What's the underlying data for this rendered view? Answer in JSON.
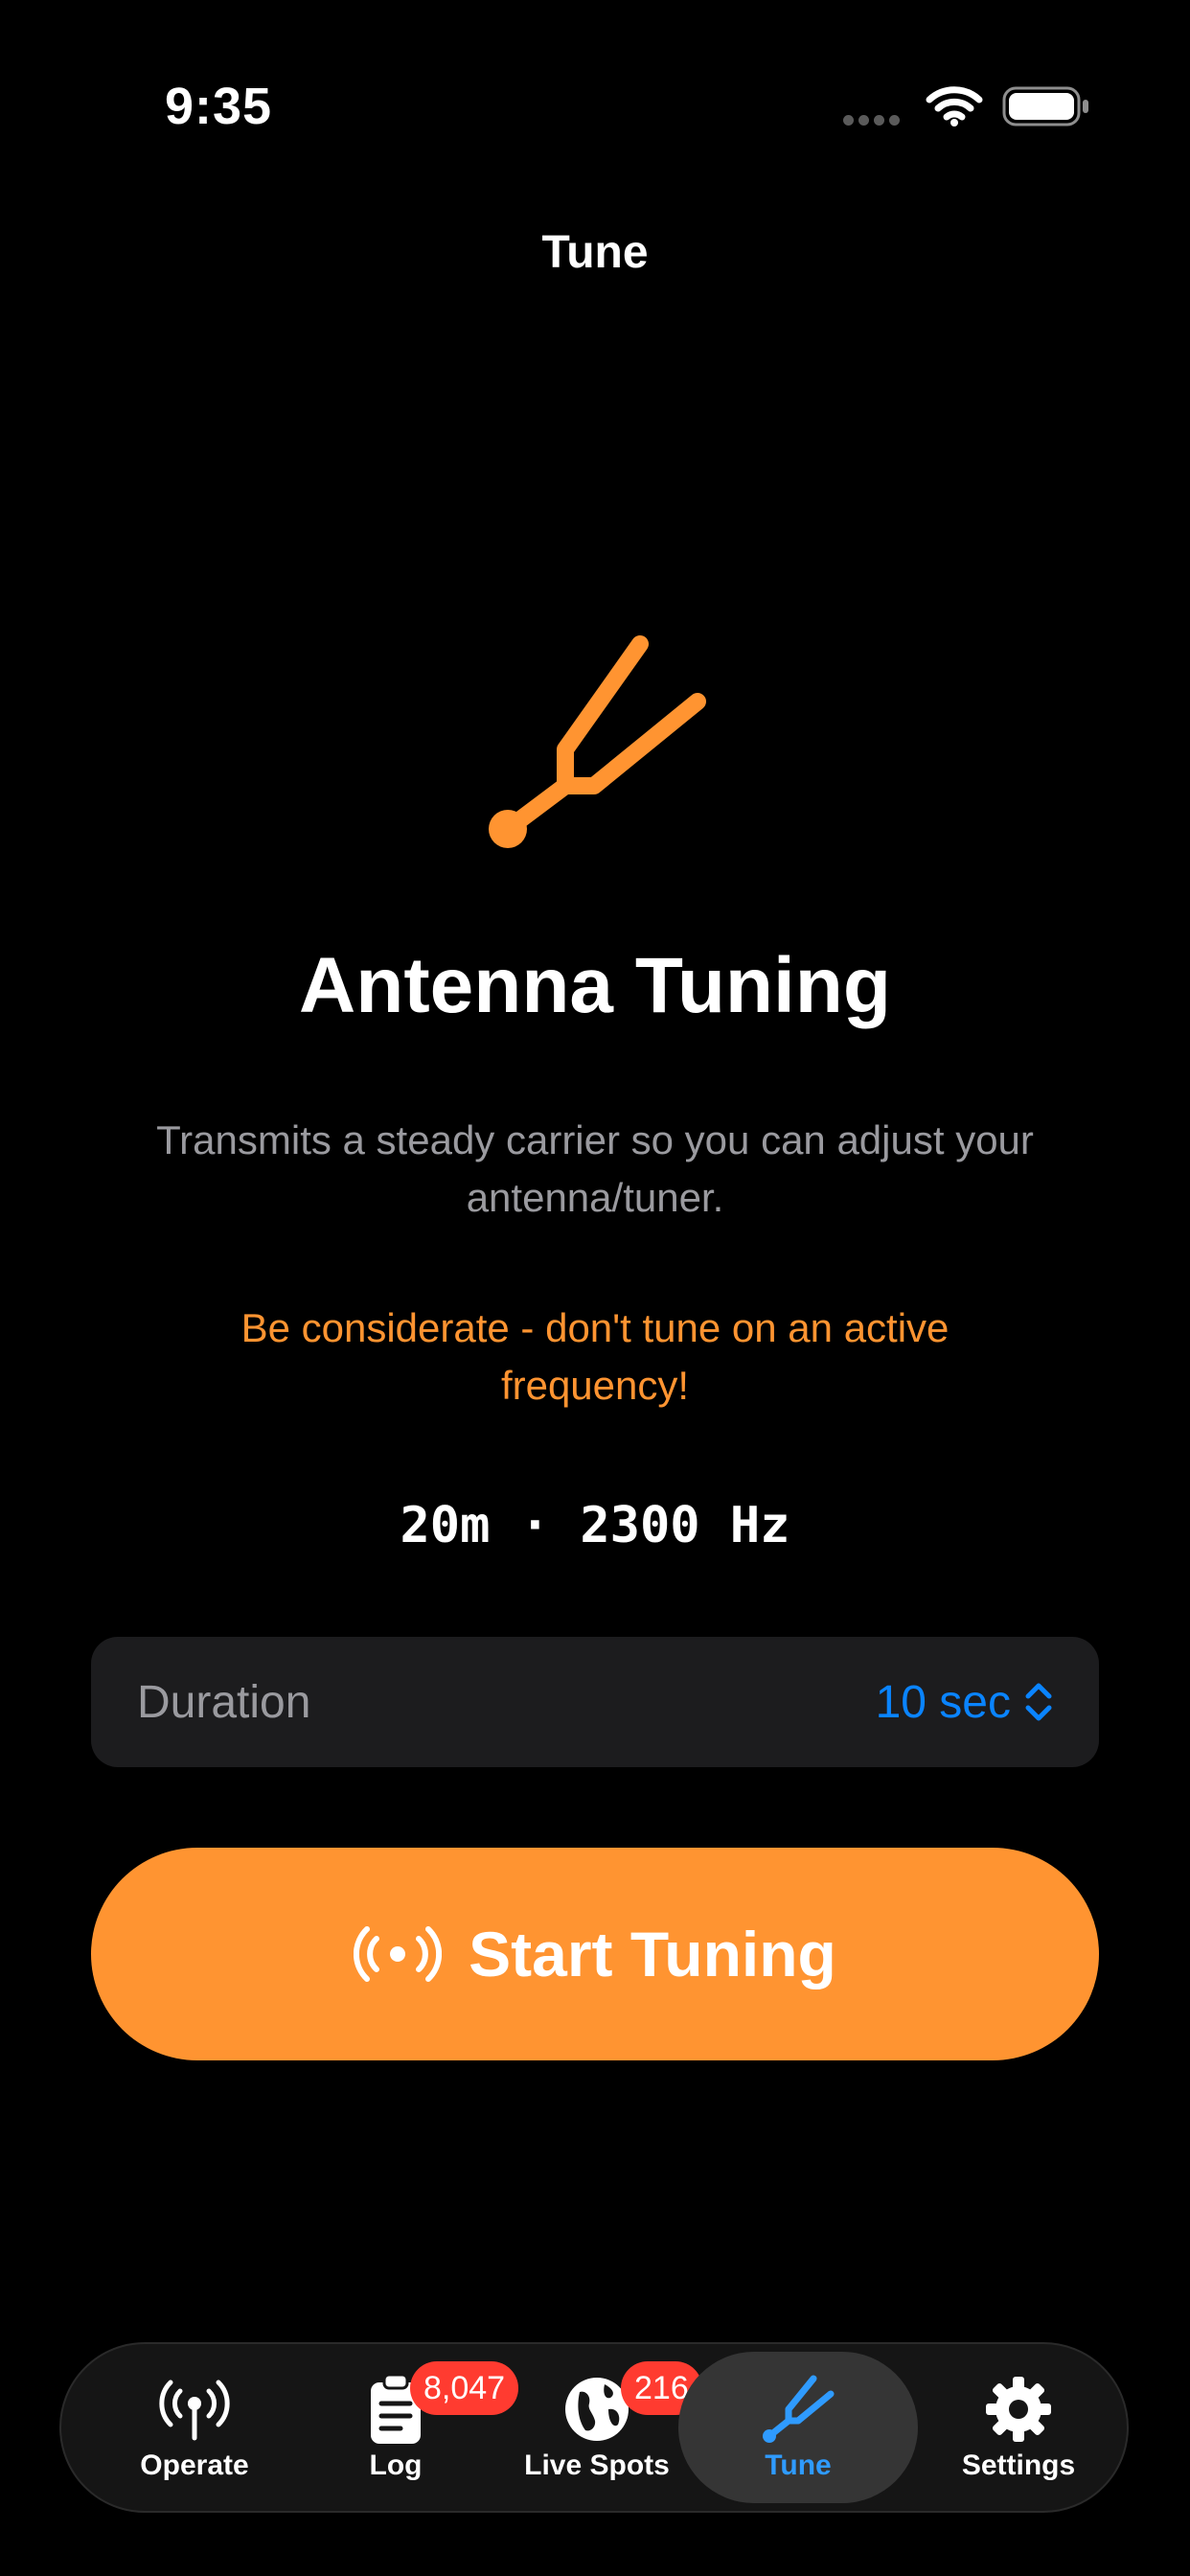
{
  "status_bar": {
    "time": "9:35"
  },
  "nav": {
    "title": "Tune"
  },
  "hero": {
    "icon": "tuning-fork-icon",
    "accent": "#ff9431"
  },
  "main": {
    "title": "Antenna Tuning",
    "description": "Transmits a steady carrier so you can adjust your antenna/tuner.",
    "warning": "Be considerate - don't tune on an active frequency!",
    "band_freq": "20m · 2300 Hz"
  },
  "duration": {
    "label": "Duration",
    "value": "10 sec"
  },
  "start_button": {
    "label": "Start Tuning",
    "icon": "broadcast-icon"
  },
  "tabs": [
    {
      "label": "Operate",
      "icon": "antenna-icon"
    },
    {
      "label": "Log",
      "icon": "clipboard-icon",
      "badge": "8,047"
    },
    {
      "label": "Live Spots",
      "icon": "globe-icon",
      "badge": "216"
    },
    {
      "label": "Tune",
      "icon": "tuning-fork-icon",
      "active": true
    },
    {
      "label": "Settings",
      "icon": "gear-icon"
    }
  ],
  "colors": {
    "accent": "#ff9431",
    "link": "#0a84ff",
    "active_tab": "#2f9bff",
    "badge": "#ff3b30"
  }
}
